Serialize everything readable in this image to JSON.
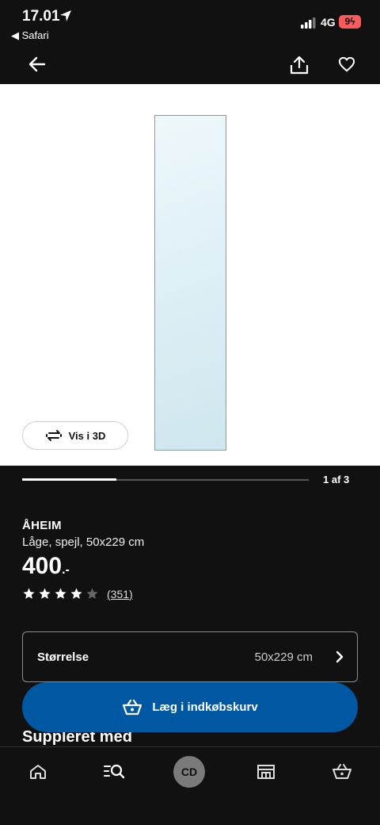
{
  "status": {
    "time": "17.01",
    "back_app": "Safari",
    "network": "4G",
    "battery": "9"
  },
  "gallery": {
    "view_3d_label": "Vis i 3D",
    "counter": "1 af 3",
    "progress_fraction": 0.33
  },
  "product": {
    "name": "ÅHEIM",
    "description": "Låge, spejl, 50x229 cm",
    "price": "400",
    "price_suffix": ".-",
    "rating": 4,
    "rating_max": 5,
    "review_count": "(351)"
  },
  "size": {
    "label": "Størrelse",
    "value": "50x229 cm"
  },
  "cart": {
    "label": "Læg i indkøbskurv"
  },
  "section": {
    "title": "Suppleret med"
  },
  "nav": {
    "avatar_initials": "CD"
  },
  "colors": {
    "accent": "#0058a3",
    "background": "#111111"
  }
}
